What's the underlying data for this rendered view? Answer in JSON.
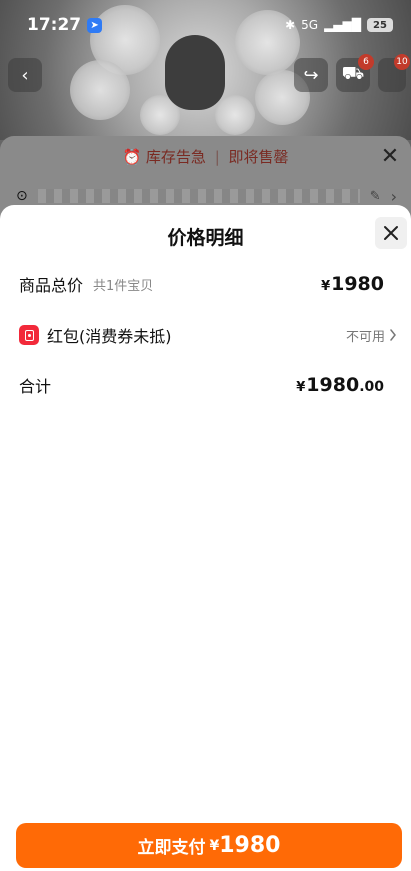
{
  "status_bar": {
    "time": "17:27",
    "network": "5G",
    "battery": "25"
  },
  "background": {
    "cart_badge": "6",
    "other_badge": "10",
    "stock_alert": "库存告急",
    "stock_alert_suffix": "即将售罄"
  },
  "sheet": {
    "title": "价格明细"
  },
  "items": {
    "total_label": "商品总价",
    "total_count": "共1件宝贝",
    "total_currency": "¥",
    "total_value": "1980",
    "redpacket_label": "红包(消费券未抵)",
    "redpacket_status": "不可用",
    "sum_label": "合计",
    "sum_currency": "¥",
    "sum_integer": "1980",
    "sum_decimal": ".00"
  },
  "pay_button": {
    "label": "立即支付",
    "currency": "¥",
    "amount": "1980"
  },
  "colors": {
    "accent": "#ff6a06",
    "redpacket": "#f2293a"
  }
}
